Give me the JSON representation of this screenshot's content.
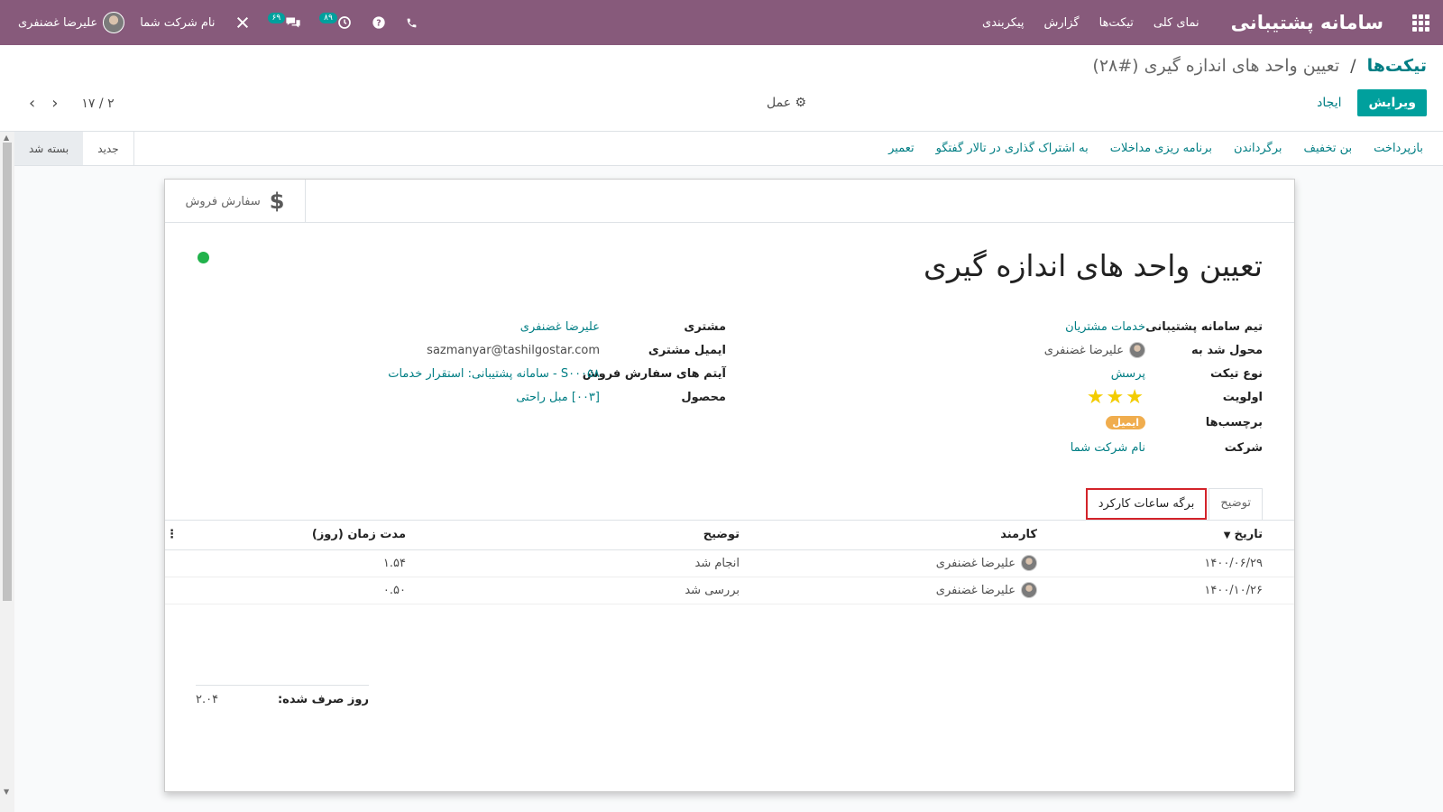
{
  "navbar": {
    "brand": "سامانه پشتیبانی",
    "menu": [
      "نمای کلی",
      "تیکت‌ها",
      "گزارش",
      "پیکربندی"
    ],
    "messages_badge": "۶۹",
    "activities_badge": "۸۹",
    "company": "نام شرکت شما",
    "user": "علیرضا غضنفری"
  },
  "control_panel": {
    "breadcrumb_parent": "تیکت‌ها",
    "breadcrumb_separator": "/",
    "breadcrumb_current": "تعیین واحد های اندازه گیری (#۲۸)",
    "edit_label": "ویرایش",
    "create_label": "ایجاد",
    "action_label": "عمل",
    "pager_value": "۱۷ / ۲"
  },
  "statusbar": {
    "buttons": [
      "بازپرداخت",
      "بن تخفیف",
      "برگرداندن",
      "برنامه ریزی مداخلات",
      "به اشتراک گذاری در تالار گفتگو",
      "تعمیر"
    ],
    "stages": [
      "جدید",
      "بسته شد"
    ],
    "active_stage": "بسته شد"
  },
  "sheet": {
    "smart_button_label": "سفارش فروش",
    "title": "تعیین واحد های اندازه گیری",
    "left_group": [
      {
        "label": "تیم سامانه پشتیبانی",
        "value": "خدمات مشتریان"
      },
      {
        "label": "محول شد به",
        "value": "علیرضا غضنفری"
      },
      {
        "label": "نوع تیکت",
        "value": "پرسش"
      },
      {
        "label": "اولویت",
        "value": "★★★"
      },
      {
        "label": "برچسب‌ها",
        "value": "ایمیل"
      },
      {
        "label": "شرکت",
        "value": "نام شرکت شما"
      }
    ],
    "right_group": [
      {
        "label": "مشتری",
        "value": "علیرضا غضنفری"
      },
      {
        "label": "ایمیل مشتری",
        "value": "sazmanyar@tashilgostar.com"
      },
      {
        "label": "آیتم های سفارش فروش",
        "value": "S۰۰۰۵۸ - سامانه پشتیبانی: استقرار خدمات"
      },
      {
        "label": "محصول",
        "value": "[۰۰۳] مبل راحتی"
      }
    ],
    "tabs": [
      "توضیح",
      "برگه ساعات کارکرد"
    ],
    "active_tab": "برگه ساعات کارکرد",
    "timesheet": {
      "columns": [
        "تاریخ",
        "کارمند",
        "توضیح",
        "مدت زمان (روز)"
      ],
      "rows": [
        {
          "date": "۱۴۰۰/۰۶/۲۹",
          "employee": "علیرضا غضنفری",
          "description": "انجام شد",
          "duration": "۱.۵۴"
        },
        {
          "date": "۱۴۰۰/۱۰/۲۶",
          "employee": "علیرضا غضنفری",
          "description": "بررسی شد",
          "duration": "۰.۵۰"
        }
      ],
      "total_label": "روز صرف شده:",
      "total_value": "۲.۰۴"
    }
  },
  "colors": {
    "navbar": "#875a7b",
    "primary": "#00a09d",
    "link": "#017e84",
    "status_dot": "#21b24b",
    "tag": "#f0ad4e",
    "highlight_border": "#d3232a"
  }
}
